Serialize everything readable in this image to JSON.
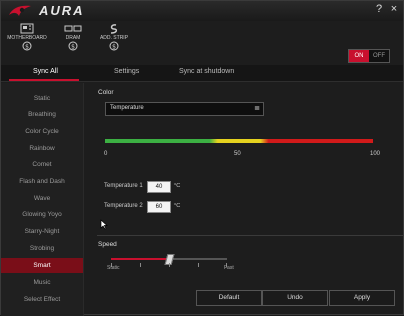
{
  "app": {
    "title": "AURA"
  },
  "window_controls": {
    "help": "?",
    "close": "×"
  },
  "devices": [
    {
      "label": "MOTHERBOARD"
    },
    {
      "label": "DRAM"
    },
    {
      "label": "ADD. STRIP"
    }
  ],
  "power_toggle": {
    "on": "ON",
    "off": "OFF",
    "state": "on"
  },
  "tabs": [
    {
      "label": "Sync All",
      "active": true
    },
    {
      "label": "Settings",
      "active": false
    },
    {
      "label": "Sync at shutdown",
      "active": false
    }
  ],
  "sidebar": {
    "items": [
      {
        "label": "Static"
      },
      {
        "label": "Breathing"
      },
      {
        "label": "Color Cycle"
      },
      {
        "label": "Rainbow"
      },
      {
        "label": "Comet"
      },
      {
        "label": "Flash and Dash"
      },
      {
        "label": "Wave"
      },
      {
        "label": "Glowing Yoyo"
      },
      {
        "label": "Starry-Night"
      },
      {
        "label": "Strobing"
      },
      {
        "label": "Smart",
        "active": true
      },
      {
        "label": "Music"
      },
      {
        "label": "Select Effect"
      }
    ]
  },
  "main": {
    "color_label": "Color",
    "color_select": "Temperature",
    "scale": {
      "min": "0",
      "mid": "50",
      "max": "100"
    },
    "gradient_colors": [
      "#3cb043",
      "#e5d21f",
      "#d11a1a"
    ],
    "temperature1": {
      "label": "Temperature 1",
      "value": "40",
      "unit": "°C"
    },
    "temperature2": {
      "label": "Temperature 2",
      "value": "60",
      "unit": "°C"
    },
    "speed_label": "Speed",
    "speed": {
      "min_label": "Static",
      "max_label": "Fast",
      "level": 0.5
    }
  },
  "buttons": {
    "default": "Default",
    "undo": "Undo",
    "apply": "Apply"
  },
  "accent": "#c8102e"
}
